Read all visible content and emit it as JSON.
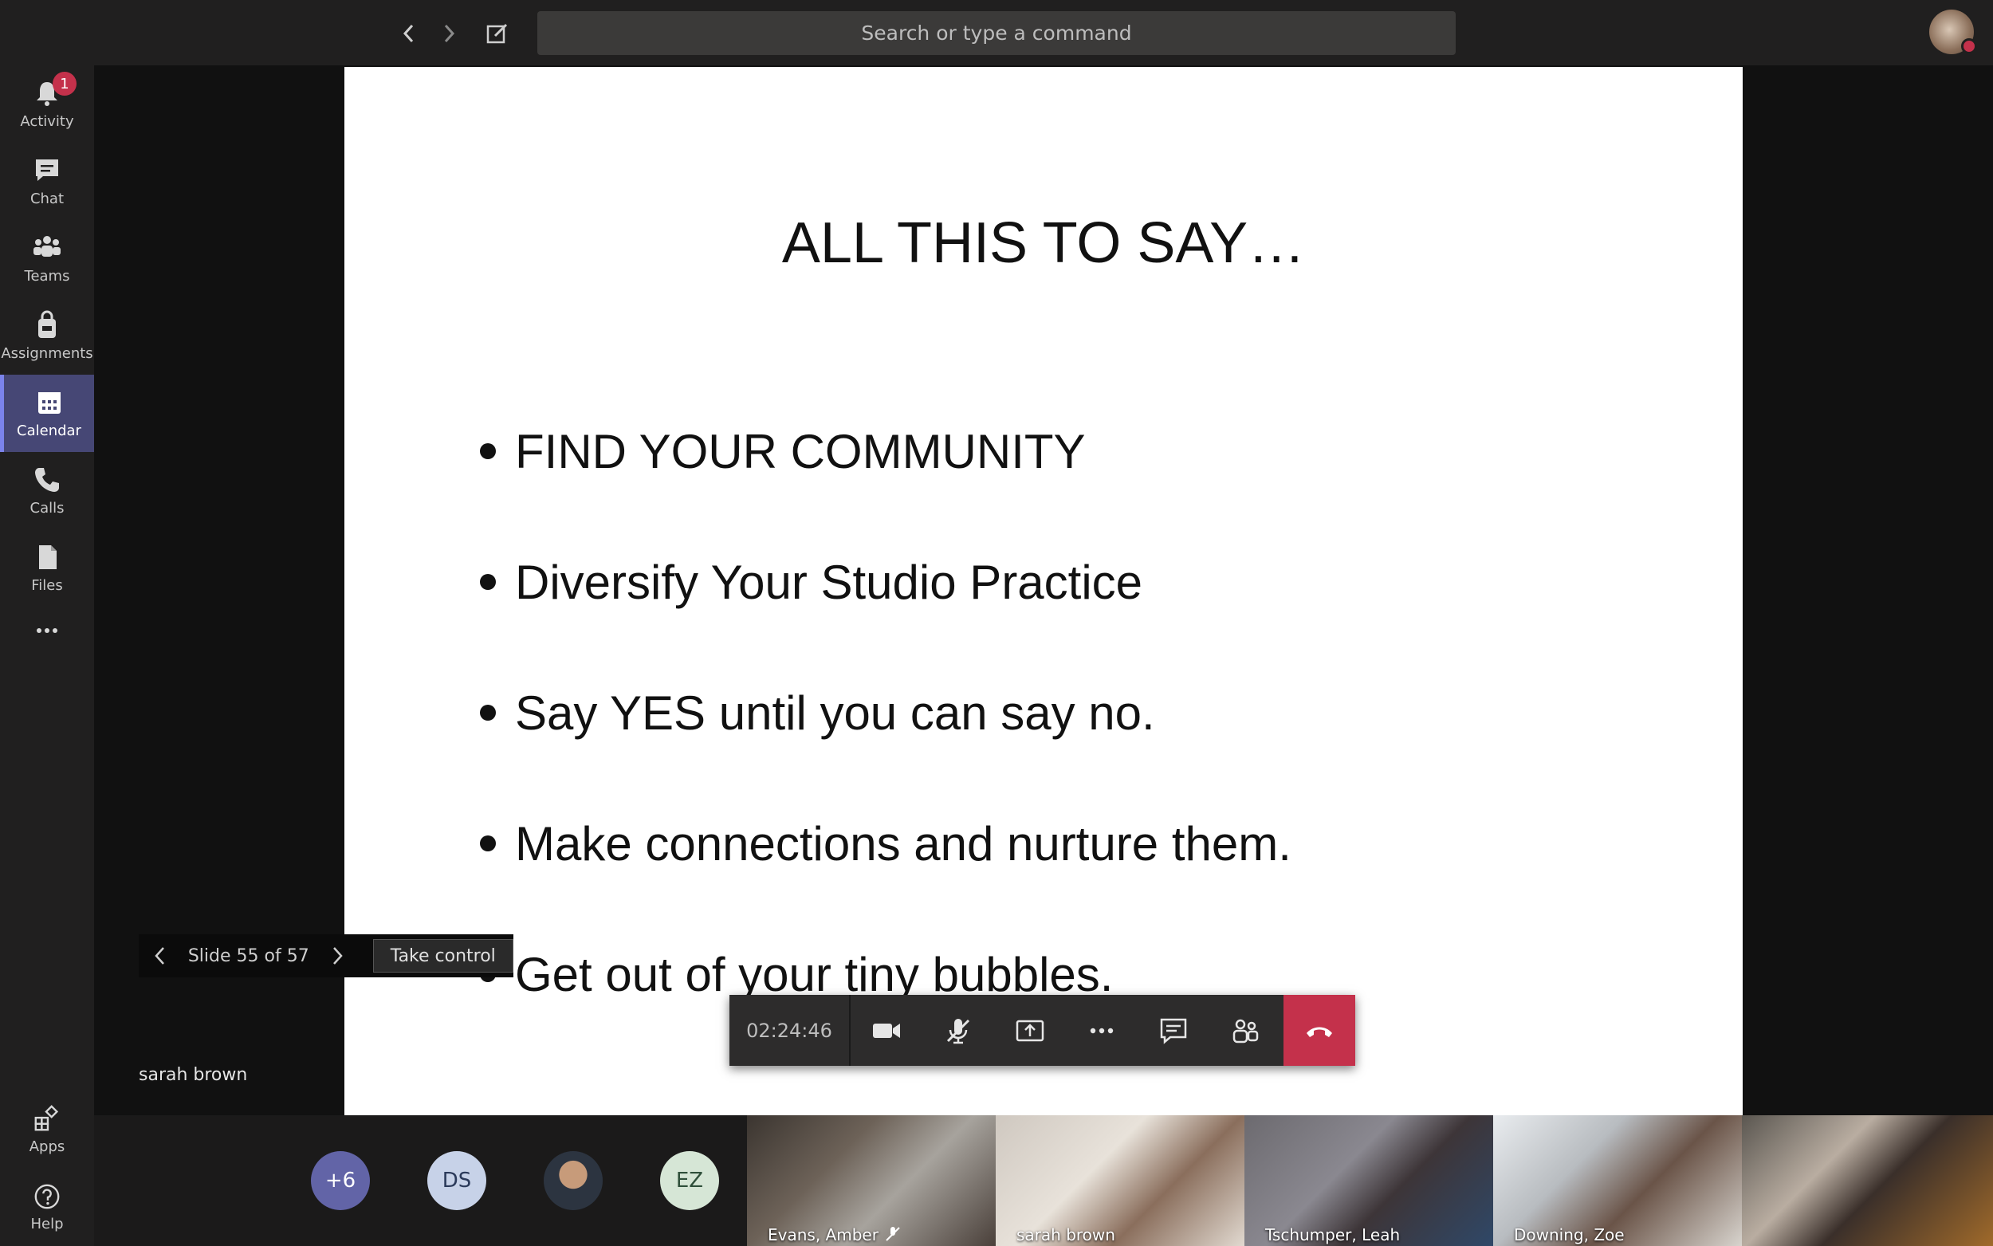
{
  "search": {
    "placeholder": "Search or type a command"
  },
  "rail": {
    "items": [
      {
        "label": "Activity",
        "icon": "bell-icon",
        "badge": "1"
      },
      {
        "label": "Chat",
        "icon": "chat-icon"
      },
      {
        "label": "Teams",
        "icon": "teams-icon"
      },
      {
        "label": "Assignments",
        "icon": "bag-icon"
      },
      {
        "label": "Calendar",
        "icon": "calendar-icon",
        "active": true
      },
      {
        "label": "Calls",
        "icon": "phone-icon"
      },
      {
        "label": "Files",
        "icon": "file-icon"
      }
    ],
    "bottom": [
      {
        "label": "Apps",
        "icon": "apps-icon"
      },
      {
        "label": "Help",
        "icon": "help-icon"
      }
    ]
  },
  "slide": {
    "title": "ALL THIS TO SAY…",
    "bullets": [
      "FIND YOUR COMMUNITY",
      "Diversify Your Studio Practice",
      "Say YES until you can say no.",
      "Make connections and nurture them.",
      "Get out of your tiny bubbles."
    ]
  },
  "slide_controls": {
    "position": "Slide 55 of 57",
    "take_control": "Take control"
  },
  "presenter": "sarah brown",
  "call": {
    "timer": "02:24:46"
  },
  "participants": {
    "more": "+6",
    "initials": [
      "DS",
      "EZ"
    ],
    "tiles": [
      "Evans, Amber",
      "sarah brown",
      "Tschumper, Leah",
      "Downing, Zoe",
      ""
    ]
  },
  "colors": {
    "accent": "#464775",
    "hangup": "#c4314b",
    "more_bubble": "#6264a7"
  }
}
